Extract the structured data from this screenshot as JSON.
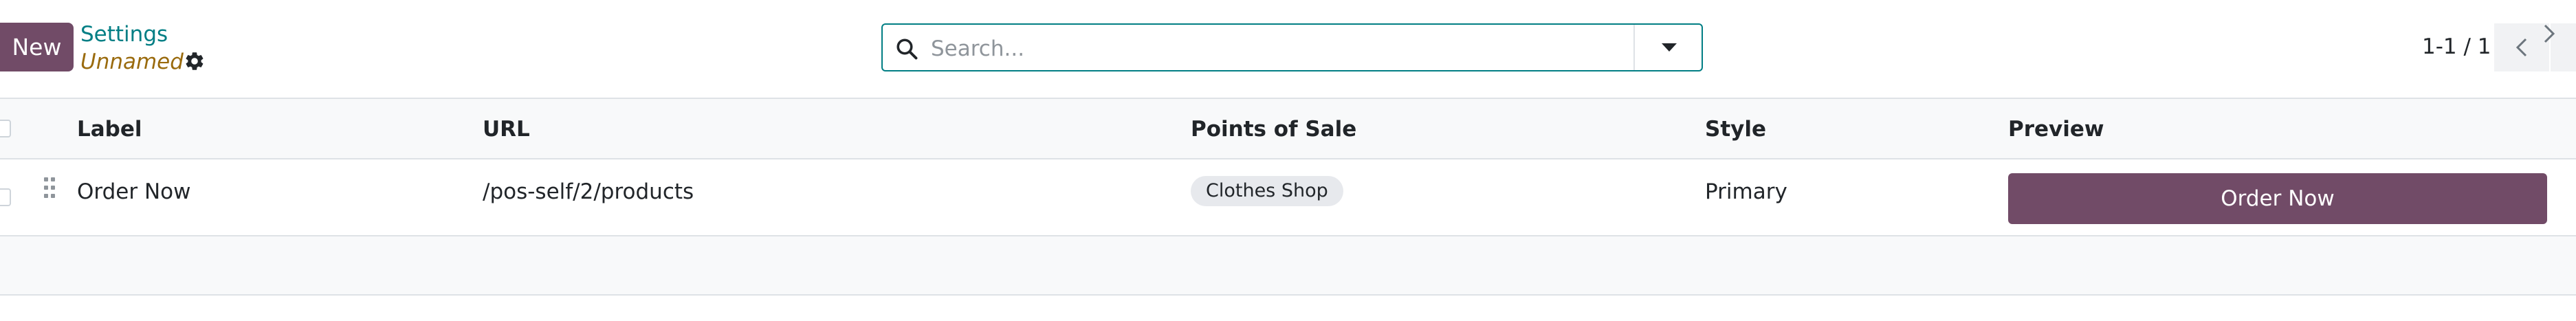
{
  "control_panel": {
    "new_button": "New",
    "breadcrumb_parent": "Settings",
    "record_name": "Unnamed",
    "search_placeholder": "Search...",
    "pager_value": "1-1 / 1"
  },
  "list": {
    "columns": [
      "Label",
      "URL",
      "Points of Sale",
      "Style",
      "Preview"
    ],
    "rows": [
      {
        "label": "Order Now",
        "url": "/pos-self/2/products",
        "points_of_sale": [
          "Clothes Shop"
        ],
        "style": "Primary",
        "preview": "Order Now"
      }
    ]
  },
  "colors": {
    "primary": "#714b67",
    "link": "#017e84",
    "record_name": "#9a6b0e",
    "header_bg": "#f8f9fa"
  },
  "icons": {
    "gear": "gear-icon",
    "search": "search-icon",
    "dropdown": "caret-down-icon",
    "pager_prev": "chevron-left-icon",
    "pager_next": "chevron-right-icon",
    "row_handle": "drag-handle-icon"
  }
}
